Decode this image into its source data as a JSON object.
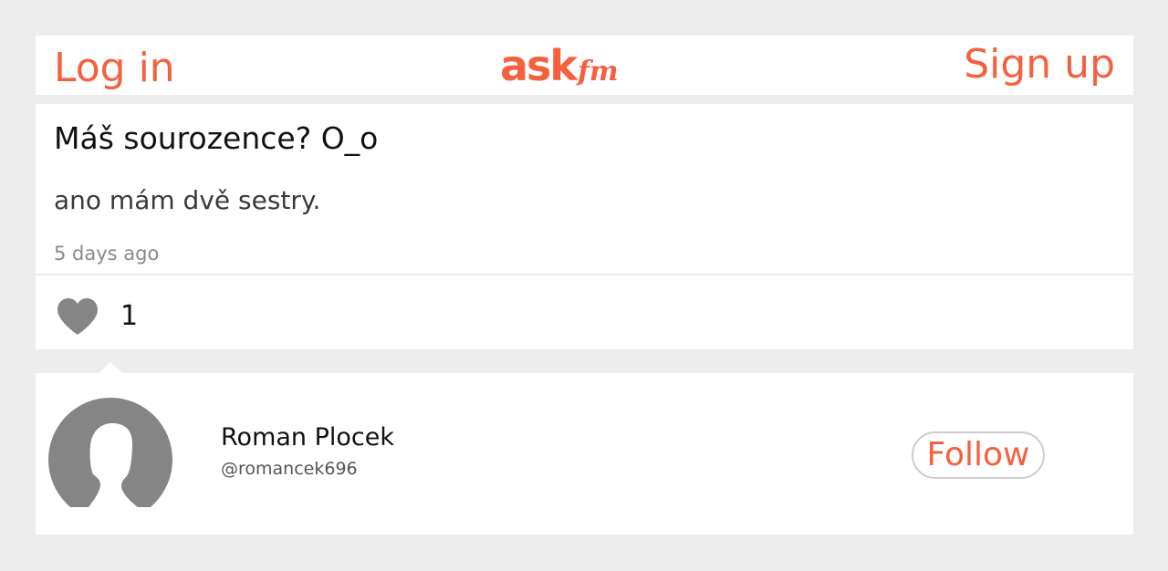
{
  "header": {
    "login_label": "Log in",
    "logo_ask": "ask",
    "logo_fm": "fm",
    "signup_label": "Sign up"
  },
  "post": {
    "question": "Máš sourozence? O_o",
    "answer": "ano mám dvě sestry.",
    "time_ago": "5 days ago",
    "like_count": "1"
  },
  "profile": {
    "name": "Roman Plocek",
    "handle": "@romancek696",
    "follow_label": "Follow"
  },
  "icons": {
    "heart": "heart-icon",
    "avatar": "default-avatar-silhouette"
  },
  "colors": {
    "accent": "#f5603f",
    "background": "#ededed",
    "card": "#ffffff",
    "icon_gray": "#858585",
    "muted_text": "#8a8a8a"
  }
}
